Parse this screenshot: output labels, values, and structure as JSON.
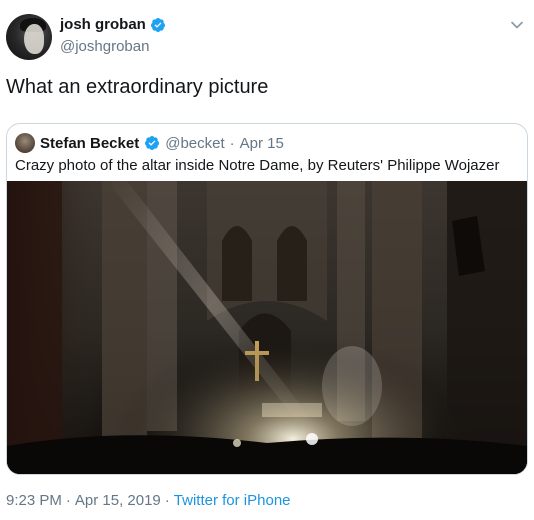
{
  "author": {
    "display_name": "josh groban",
    "handle": "@joshgroban",
    "verified_icon": "verified-badge-icon",
    "menu_icon": "chevron-down-icon"
  },
  "tweet": {
    "text": "What an extraordinary picture"
  },
  "quoted_tweet": {
    "display_name": "Stefan Becket",
    "handle": "@becket",
    "separator": "·",
    "date": "Apr 15",
    "text": "Crazy photo of the altar inside Notre Dame, by Reuters' Philippe Wojazer"
  },
  "footer": {
    "time": "9:23 PM",
    "separator1": "·",
    "date": "Apr 15, 2019",
    "separator2": "·",
    "source": "Twitter for iPhone"
  },
  "colors": {
    "text": "#14171a",
    "secondary": "#657786",
    "link": "#1b95e0",
    "border": "#ccd6dd",
    "verified": "#1da1f2"
  }
}
